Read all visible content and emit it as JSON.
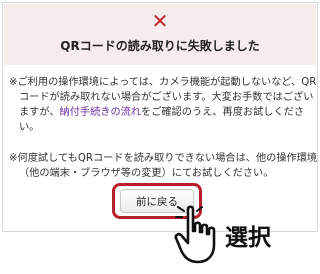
{
  "error": {
    "icon": "close-icon",
    "title": "QRコードの読み取りに失敗しました",
    "accent_color": "#c0262d",
    "background_color": "#f7ecec"
  },
  "notes": [
    {
      "text_before": "※ご利用の操作環境によっては、カメラ機能が起動しないなど、QRコードが読み取れない場合がございます。大変お手数ではございますが、",
      "link": "納付手続きの流れ",
      "text_after": "をご確認のうえ、再度お試しください。"
    },
    {
      "text": "※何度試してもQRコードを読み取りできない場合は、他の操作環境（他の端末・ブラウザ等の変更）にてお試しください。"
    }
  ],
  "back_button": {
    "label": "前に戻る",
    "highlight_color": "#b5202b"
  },
  "annotation": {
    "icon": "pointing-hand-icon",
    "label": "選択"
  }
}
